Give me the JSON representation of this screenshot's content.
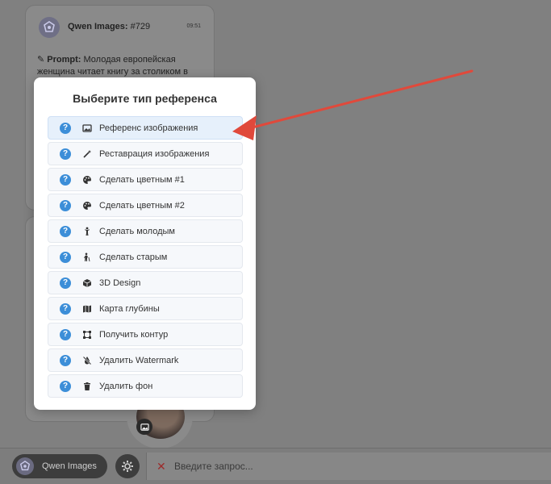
{
  "chat": {
    "bot_name": "Qwen Images:",
    "message_number": "#729",
    "time": "09:51",
    "prompt_label": "Prompt:",
    "prompt_text": "Молодая европейская женщина читает книгу за столиком в"
  },
  "modal": {
    "title": "Выберите тип референса",
    "options": [
      {
        "label": "Референс изображения",
        "icon": "image-icon"
      },
      {
        "label": "Реставрация изображения",
        "icon": "magic-wand-icon"
      },
      {
        "label": "Сделать цветным #1",
        "icon": "palette-icon"
      },
      {
        "label": "Сделать цветным #2",
        "icon": "palette-icon"
      },
      {
        "label": "Сделать молодым",
        "icon": "child-icon"
      },
      {
        "label": "Сделать старым",
        "icon": "elderly-icon"
      },
      {
        "label": "3D Design",
        "icon": "cube-icon"
      },
      {
        "label": "Карта глубины",
        "icon": "map-icon"
      },
      {
        "label": "Получить контур",
        "icon": "vector-square-icon"
      },
      {
        "label": "Удалить Watermark",
        "icon": "droplet-slash-icon"
      },
      {
        "label": "Удалить фон",
        "icon": "trash-icon"
      }
    ],
    "help_glyph": "?"
  },
  "bottom_bar": {
    "model_label": "Qwen Images",
    "clear_glyph": "✕",
    "input_placeholder": "Введите запрос..."
  },
  "colors": {
    "accent_blue": "#3c8ed8",
    "arrow_red": "#e0493b",
    "active_option_bg": "#e6f0fb"
  }
}
